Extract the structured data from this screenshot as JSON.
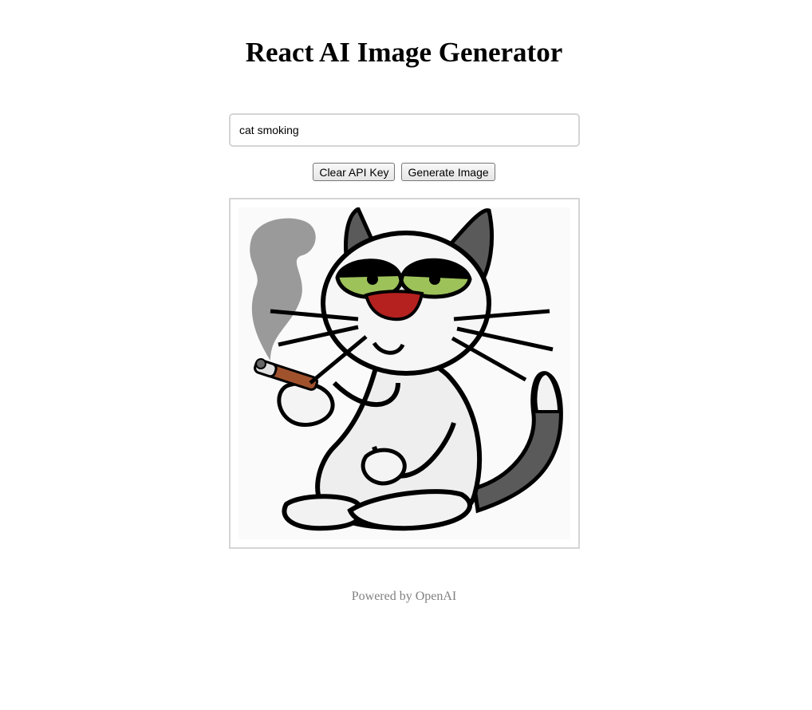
{
  "header": {
    "title": "React AI Image Generator"
  },
  "prompt": {
    "value": "cat smoking",
    "placeholder": ""
  },
  "buttons": {
    "clear_api_key": "Clear API Key",
    "generate_image": "Generate Image"
  },
  "generated_image": {
    "alt": "cat smoking",
    "icon": "cartoon-cat-smoking-image"
  },
  "footer": {
    "text": "Powered by OpenAI"
  },
  "colors": {
    "frame_border": "#d5d5d5",
    "footer_text": "#808080",
    "cat_eye_green": "#9dc25a",
    "cat_mouth_red": "#b5211f",
    "cigarette_brown": "#a0522d",
    "smoke_gray": "#9a9a9a"
  }
}
